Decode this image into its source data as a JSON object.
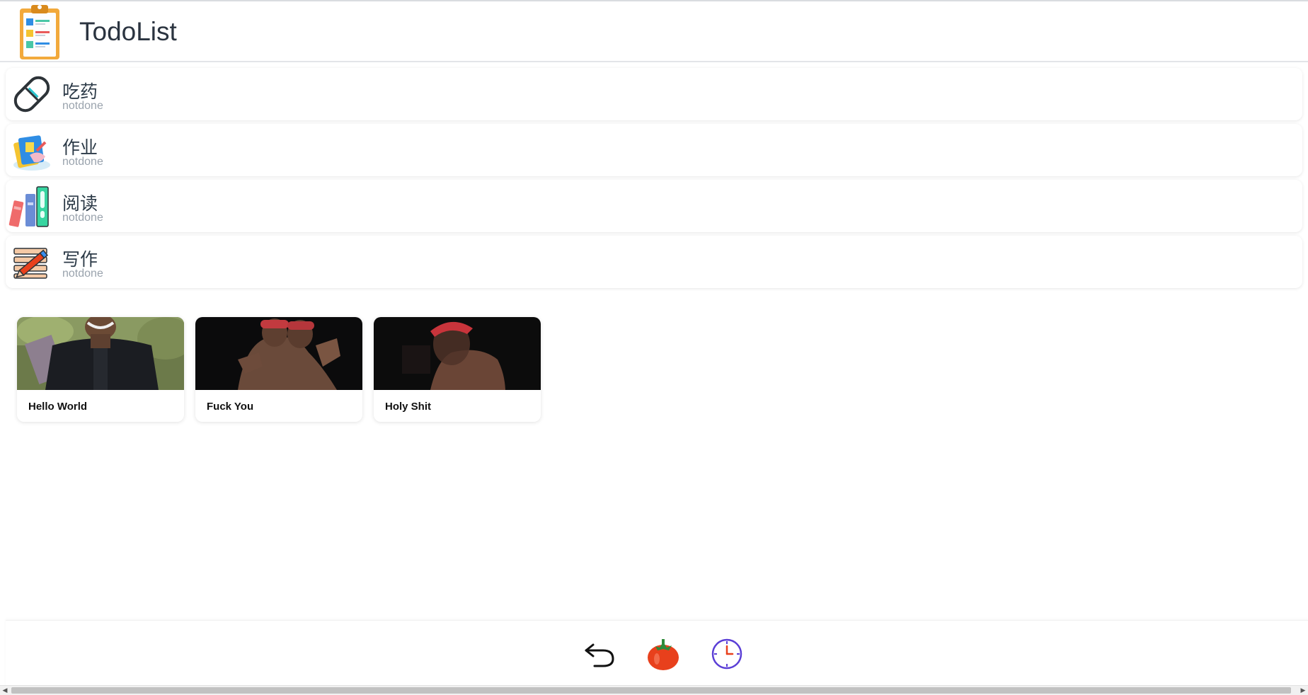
{
  "header": {
    "title": "TodoList",
    "logo_icon": "clipboard-icon"
  },
  "todos": [
    {
      "title": "吃药",
      "status": "notdone",
      "icon": "pill-icon"
    },
    {
      "title": "作业",
      "status": "notdone",
      "icon": "homework-icon"
    },
    {
      "title": "阅读",
      "status": "notdone",
      "icon": "books-icon"
    },
    {
      "title": "写作",
      "status": "notdone",
      "icon": "writing-icon"
    }
  ],
  "gifs": [
    {
      "title": "Hello World"
    },
    {
      "title": "Fuck You"
    },
    {
      "title": "Holy Shit"
    }
  ],
  "bottom_nav": [
    {
      "icon": "undo-icon"
    },
    {
      "icon": "tomato-icon"
    },
    {
      "icon": "clock-icon"
    }
  ],
  "colors": {
    "accent_clock": "#5b3fd6",
    "tomato": "#e8401c",
    "status_text": "#9aa3ad"
  }
}
